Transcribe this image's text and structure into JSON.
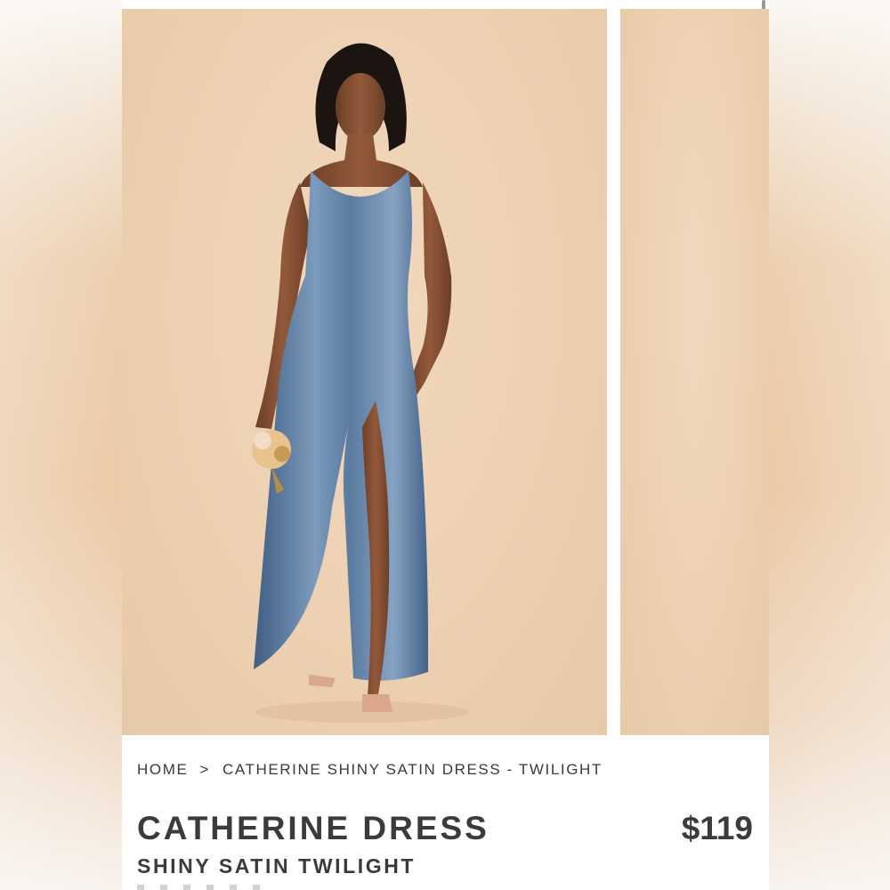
{
  "breadcrumb": {
    "home": "HOME",
    "separator": ">",
    "current": "CATHERINE SHINY SATIN DRESS - TWILIGHT"
  },
  "product": {
    "title": "CATHERINE DRESS",
    "subtitle": "SHINY SATIN TWILIGHT",
    "price": "$119"
  },
  "gallery": {
    "images": [
      "model-in-twilight-satin-dress",
      "next-product-image"
    ],
    "backdrop_color": "#ecd0b1",
    "dress_color": "#5d7c9e"
  }
}
